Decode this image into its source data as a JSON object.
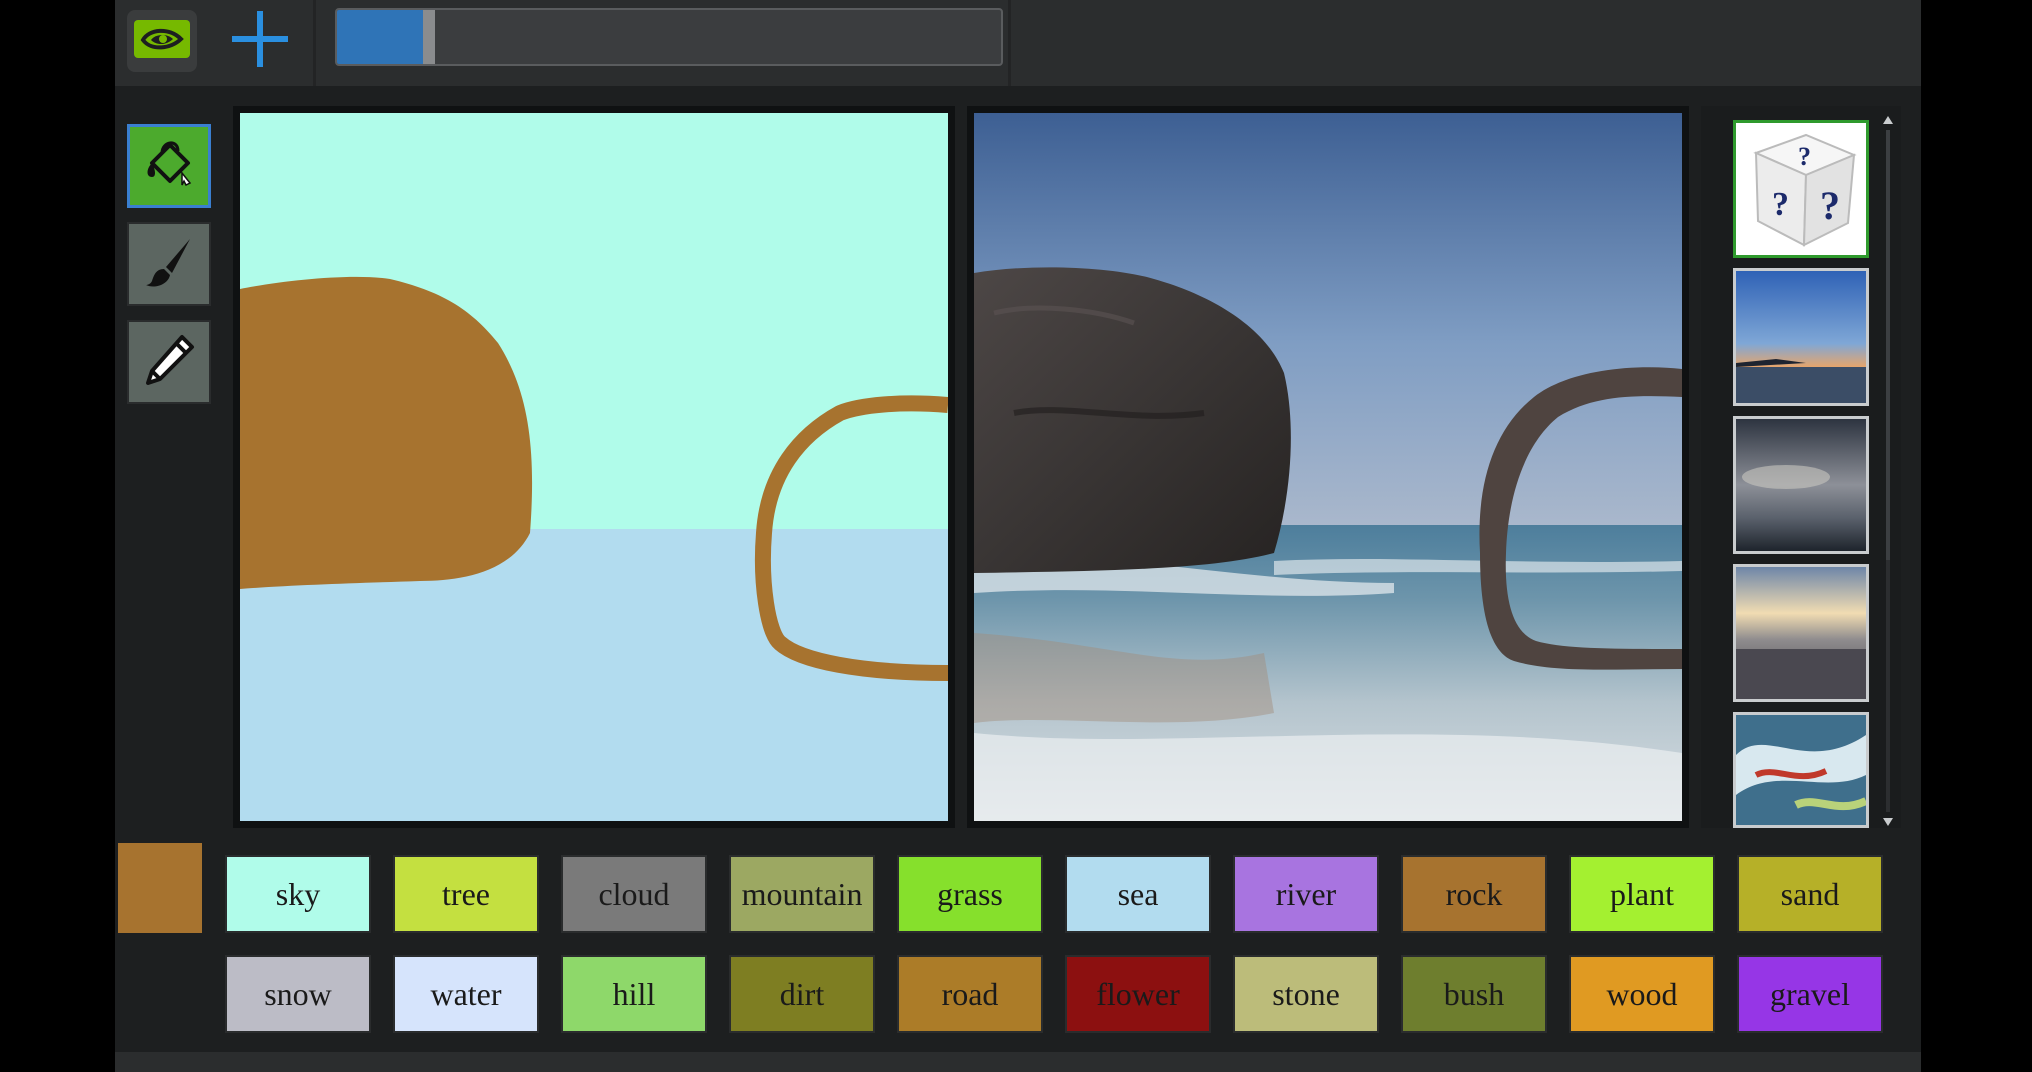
{
  "topbar": {
    "logo_icon": "nvidia-logo-icon",
    "add_icon": "plus-icon",
    "progress_fraction": 0.13
  },
  "tools": [
    {
      "name": "fill-bucket-icon",
      "active": true
    },
    {
      "name": "paintbrush-icon",
      "active": false
    },
    {
      "name": "pencil-icon",
      "active": false
    }
  ],
  "current_color": "#a7732f",
  "gallery": [
    {
      "name": "random-style-dice",
      "selected": true
    },
    {
      "name": "sunset-sea-style",
      "selected": false
    },
    {
      "name": "cloudy-sky-style",
      "selected": false
    },
    {
      "name": "overcast-beach-style",
      "selected": false
    },
    {
      "name": "painted-waves-style",
      "selected": false
    }
  ],
  "labels": [
    {
      "text": "sky",
      "color": "#b0fcea"
    },
    {
      "text": "tree",
      "color": "#c4e040"
    },
    {
      "text": "cloud",
      "color": "#7a7a7a"
    },
    {
      "text": "mountain",
      "color": "#9ca862"
    },
    {
      "text": "grass",
      "color": "#86e02c"
    },
    {
      "text": "sea",
      "color": "#b2dcef"
    },
    {
      "text": "river",
      "color": "#a874e0"
    },
    {
      "text": "rock",
      "color": "#a7732f"
    },
    {
      "text": "plant",
      "color": "#a4f030"
    },
    {
      "text": "sand",
      "color": "#b6b028"
    },
    {
      "text": "snow",
      "color": "#bcbcc6"
    },
    {
      "text": "water",
      "color": "#d6e4fc"
    },
    {
      "text": "hill",
      "color": "#8ed86a"
    },
    {
      "text": "dirt",
      "color": "#7e7e22"
    },
    {
      "text": "road",
      "color": "#ac7c28"
    },
    {
      "text": "flower",
      "color": "#8c1010"
    },
    {
      "text": "stone",
      "color": "#bcbc7a"
    },
    {
      "text": "bush",
      "color": "#6e7e2e"
    },
    {
      "text": "wood",
      "color": "#e09a22"
    },
    {
      "text": "gravel",
      "color": "#9636e6"
    }
  ],
  "segmentation": {
    "sky_color": "#b0fcea",
    "sea_color": "#b2dcef",
    "rock_color": "#a7732f"
  }
}
